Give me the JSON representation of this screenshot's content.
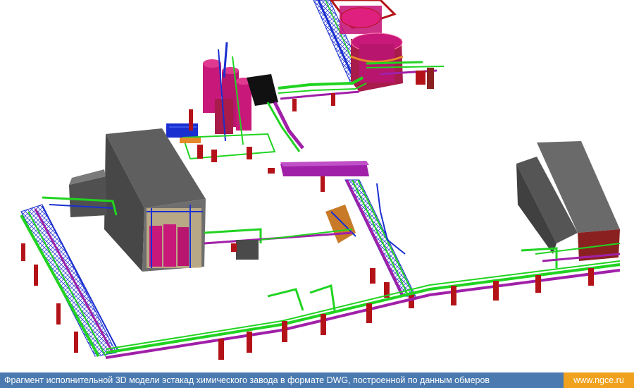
{
  "caption": {
    "text": "Фрагмент исполнительной 3D модели эстакад химического завода в формате DWG, построенной по данным обмеров",
    "site": "www.ngce.ru"
  },
  "colors": {
    "pipe_green": "#21d321",
    "pipe_magenta": "#a020a8",
    "support_red": "#b31318",
    "steel_blue": "#1a2fd0",
    "tank_magenta": "#c8197a",
    "building_gray": "#6e6e6e",
    "caption_bg": "#4a7ab0",
    "site_bg": "#f0a21e"
  }
}
